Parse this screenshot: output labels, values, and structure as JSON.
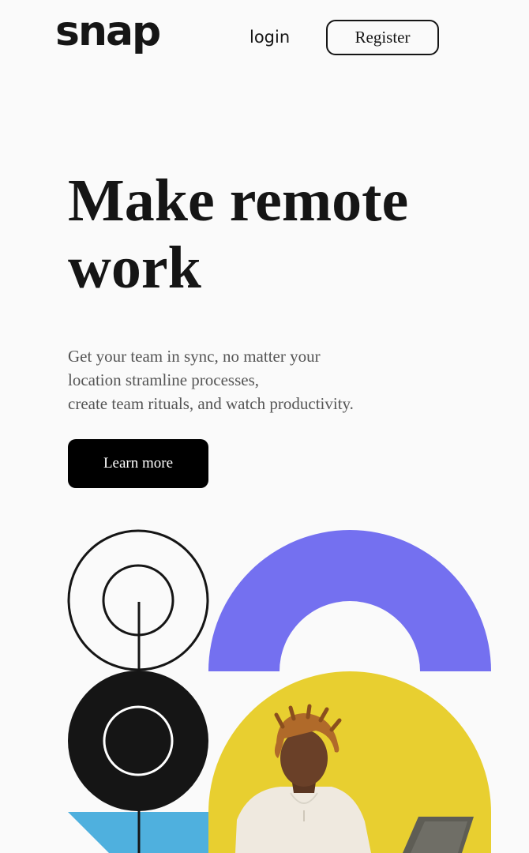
{
  "header": {
    "logo": "snap",
    "login_label": "login",
    "register_label": "Register"
  },
  "hero": {
    "title": "Make remote work",
    "description_lines": [
      "Get your team in sync, no matter your",
      "location stramline processes,",
      "create team rituals, and watch productivity."
    ],
    "cta_label": "Learn more"
  },
  "illustration": {
    "colors": {
      "purple_arch": "#7470f0",
      "yellow_circle": "#e8cf30",
      "black_circle": "#151515",
      "blue_shape": "#4fb0de",
      "outline": "#151515"
    }
  }
}
